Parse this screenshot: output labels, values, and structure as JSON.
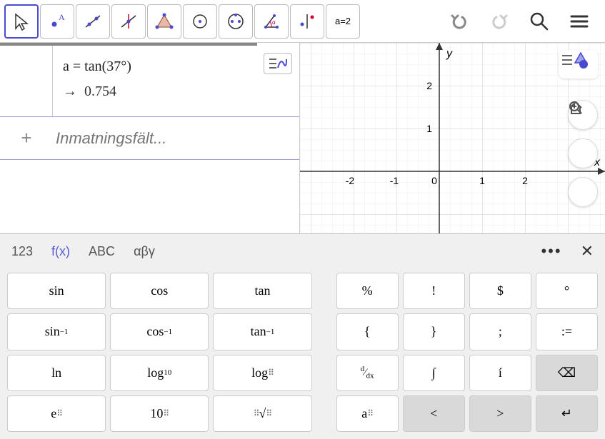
{
  "toolbar": {
    "tools": [
      {
        "name": "move",
        "selected": true
      },
      {
        "name": "point"
      },
      {
        "name": "line"
      },
      {
        "name": "perpendicular"
      },
      {
        "name": "polygon"
      },
      {
        "name": "circle"
      },
      {
        "name": "ellipse"
      },
      {
        "name": "angle"
      },
      {
        "name": "reflect"
      },
      {
        "name": "slider",
        "label": "a=2"
      }
    ],
    "right": [
      "undo",
      "redo",
      "search",
      "menu"
    ]
  },
  "algebra": {
    "entry": {
      "expr_var": "a",
      "expr_eq": " = ",
      "expr_func": "tan",
      "expr_arg": "(37°)",
      "arrow": "→",
      "result": "0.754"
    },
    "input_placeholder": "Inmatningsfält..."
  },
  "graphics": {
    "x_label": "x",
    "y_label": "y",
    "x_ticks": [
      "-2",
      "-1",
      "0",
      "1",
      "2"
    ],
    "y_ticks": [
      "1",
      "2"
    ]
  },
  "keyboard": {
    "tabs": [
      {
        "id": "123",
        "label": "123"
      },
      {
        "id": "fx",
        "label": "f(x)",
        "active": true
      },
      {
        "id": "abc",
        "label": "ABC"
      },
      {
        "id": "greek",
        "label": "αβγ"
      }
    ],
    "rows": [
      [
        {
          "t": "sin",
          "w": true
        },
        {
          "t": "cos",
          "w": true
        },
        {
          "t": "tan",
          "w": true
        },
        "gap",
        {
          "t": "%"
        },
        {
          "t": "!"
        },
        {
          "t": "$"
        },
        {
          "t": "°"
        }
      ],
      [
        {
          "html": "sin<sup>−1</sup>",
          "w": true,
          "n": "asin"
        },
        {
          "html": "cos<sup>−1</sup>",
          "w": true,
          "n": "acos"
        },
        {
          "html": "tan<sup>−1</sup>",
          "w": true,
          "n": "atan"
        },
        "gap",
        {
          "t": "{"
        },
        {
          "t": "}"
        },
        {
          "t": ";"
        },
        {
          "t": ":="
        }
      ],
      [
        {
          "t": "ln",
          "w": true
        },
        {
          "html": "log<sub>10</sub>",
          "w": true,
          "n": "log10"
        },
        {
          "html": "log<sub><span class='dots'>⠿</span></sub>",
          "w": true,
          "n": "logn"
        },
        "gap",
        {
          "html": "<span style='font-size:14px'><sup>d</sup>⁄<sub>dx</sub></span>",
          "n": "deriv"
        },
        {
          "t": "∫",
          "n": "integral"
        },
        {
          "t": "í",
          "n": "i-acute"
        },
        {
          "html": "⌫",
          "n": "backspace",
          "gray": true
        }
      ],
      [
        {
          "html": "e<sup><span class='dots'>⠿</span></sup>",
          "w": true,
          "n": "exp"
        },
        {
          "html": "10<sup><span class='dots'>⠿</span></sup>",
          "w": true,
          "n": "pow10"
        },
        {
          "html": "<sup><span class='dots'>⠿</span></sup>√<span class='dots'>⠿</span>",
          "w": true,
          "n": "nroot"
        },
        "gap",
        {
          "html": "a<sub><span class='dots'>⠿</span></sub>",
          "n": "subscript"
        },
        {
          "t": "<",
          "n": "left",
          "gray": true
        },
        {
          "t": ">",
          "n": "right",
          "gray": true
        },
        {
          "html": "↵",
          "n": "enter",
          "gray": true
        }
      ]
    ]
  }
}
